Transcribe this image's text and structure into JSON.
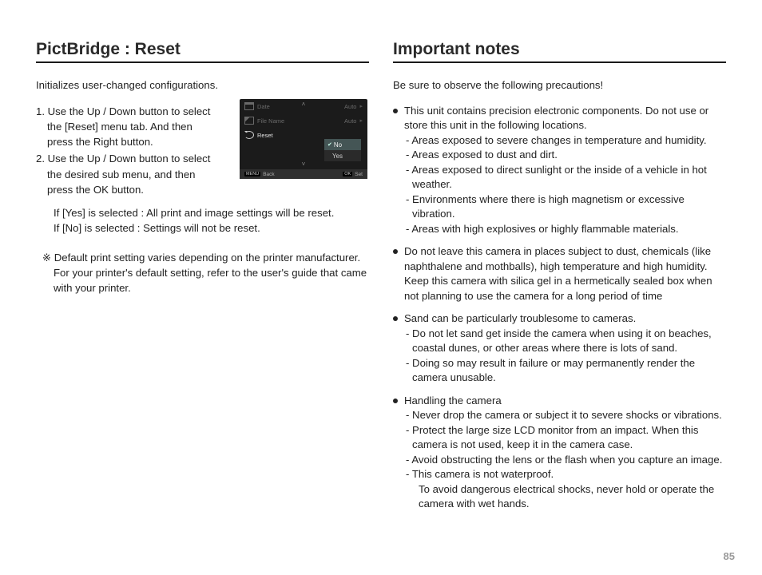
{
  "page_number": "85",
  "left": {
    "title": "PictBridge : Reset",
    "intro": "Initializes user-changed configurations.",
    "step1": "1. Use the Up / Down button to select the [Reset] menu tab. And then press the Right button.",
    "step2": "2. Use the Up / Down button to select the desired sub menu, and then press the OK button.",
    "ifyes": "If [Yes] is selected : All print and image settings will be reset.",
    "ifno": "If [No] is selected  : Settings will not be reset.",
    "note1": "※ Default print setting varies depending on the printer manufacturer.",
    "note2": "For your printer's default setting, refer to the user's guide that came with your printer."
  },
  "lcd": {
    "row1_label": "Date",
    "row1_value": "Auto",
    "row2_label": "File Name",
    "row2_value": "Auto",
    "row3_label": "Reset",
    "opt_no": "No",
    "opt_yes": "Yes",
    "footer_back_key": "MENU",
    "footer_back": "Back",
    "footer_set_key": "OK",
    "footer_set": "Set"
  },
  "right": {
    "title": "Important notes",
    "intro": "Be sure to observe the following precautions!",
    "b1": "This unit contains precision electronic components. Do not use or store this unit in the following locations.",
    "b1s1": "- Areas exposed to severe changes in temperature and humidity.",
    "b1s2": "- Areas exposed to dust and dirt.",
    "b1s3": "- Areas exposed to direct sunlight or the inside of a vehicle in hot weather.",
    "b1s4": "- Environments where there is high magnetism or excessive vibration.",
    "b1s5": "- Areas with high explosives or highly flammable materials.",
    "b2": "Do not leave this camera in places subject to dust, chemicals (like naphthalene and mothballs), high temperature and high humidity. Keep this camera with silica gel in a hermetically sealed box when not planning to use the camera for a long period of time",
    "b3": "Sand can be particularly troublesome to cameras.",
    "b3s1": "- Do not let sand get inside the camera when using it on beaches, coastal dunes, or other areas where there is lots of sand.",
    "b3s2": "- Doing so may result in failure or may permanently render the camera unusable.",
    "b4": "Handling the camera",
    "b4s1": "- Never drop the camera or subject it to severe shocks or vibrations.",
    "b4s2": "- Protect the large size LCD monitor from an impact. When this camera is not used, keep it in the camera case.",
    "b4s3": "- Avoid obstructing the lens or the flash when you capture an image.",
    "b4s4": "- This camera is not waterproof.",
    "b4s4b": "To avoid dangerous electrical shocks, never hold or operate the camera with wet hands."
  }
}
